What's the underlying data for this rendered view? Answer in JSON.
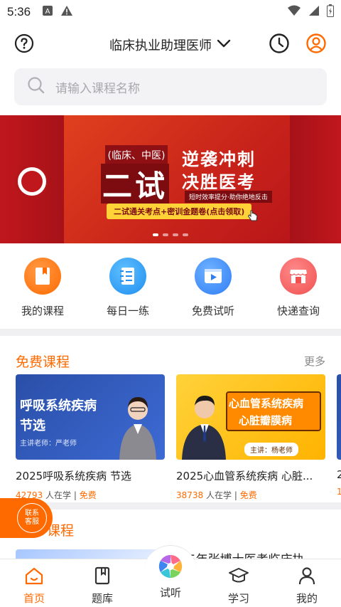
{
  "status_bar": {
    "time": "5:36"
  },
  "header": {
    "title": "临床执业助理医师"
  },
  "search": {
    "placeholder": "请输入课程名称"
  },
  "banner": {
    "tag": "(临床、中医)",
    "big": "二试",
    "headline1": "逆袭冲刺",
    "headline2": "决胜医考",
    "subline": "短时效率提分·助你绝地反击",
    "cta": "二试通关考点+密训金题卷(点击领取)"
  },
  "quick_entries": [
    {
      "label": "我的课程",
      "icon": "bookmark-book-icon",
      "color": "#ff7a1a"
    },
    {
      "label": "每日一练",
      "icon": "list-notebook-icon",
      "color": "#2a9df4"
    },
    {
      "label": "免费试听",
      "icon": "play-video-icon",
      "color": "#2f7ef6"
    },
    {
      "label": "快递查询",
      "icon": "shop-icon",
      "color": "#f25a5a"
    }
  ],
  "free_courses": {
    "title": "免费课程",
    "more": "更多",
    "items": [
      {
        "thumb_line1": "呼吸系统疾病",
        "thumb_line2": "节选",
        "thumb_teacher": "主讲老师：严老师",
        "title": "2025呼吸系统疾病 节选",
        "learners": "42793",
        "learners_suffix": "人在学",
        "sep": "|",
        "price": "免费"
      },
      {
        "thumb_line1": "心血管系统疾病",
        "thumb_line2": "心脏瓣膜病",
        "thumb_teacher": "主讲：杨老师",
        "title": "2025心血管系统疾病 心脏...",
        "learners": "38738",
        "learners_suffix": "人在学",
        "sep": "|",
        "price": "免费"
      },
      {
        "title": "2",
        "learners": "1"
      }
    ]
  },
  "section2": {
    "title": "课程",
    "peek_text": "25年张博士医考临床执"
  },
  "contact": {
    "line1": "联系",
    "line2": "客服"
  },
  "bottom_nav": [
    {
      "label": "首页",
      "icon": "home-icon",
      "active": true
    },
    {
      "label": "题库",
      "icon": "book-icon",
      "active": false
    },
    {
      "label": "试听",
      "icon": "aperture-icon",
      "active": false
    },
    {
      "label": "学习",
      "icon": "graduation-cap-icon",
      "active": false
    },
    {
      "label": "我的",
      "icon": "person-icon",
      "active": false
    }
  ],
  "colors": {
    "accent": "#ff6a00",
    "banner_red": "#c0171d"
  }
}
